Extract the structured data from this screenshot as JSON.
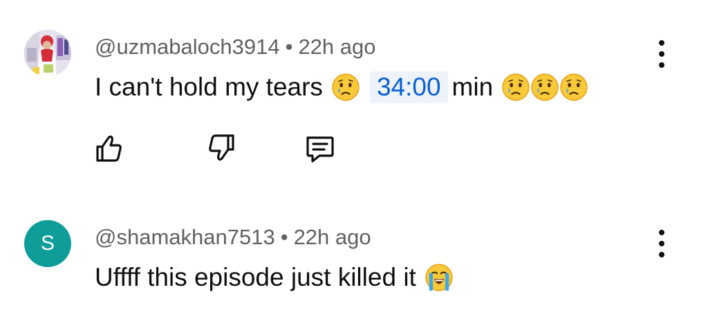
{
  "comments": [
    {
      "handle": "@uzmabaloch3914",
      "separator": "•",
      "time": "22h ago",
      "text_before": "I can't hold my tears",
      "timestamp_link": "34:00",
      "text_after": "min",
      "avatar_icon": "profile-photo",
      "emoji_name": "crying-face"
    },
    {
      "handle": "@shamakhan7513",
      "separator": "•",
      "time": "22h ago",
      "text": "Uffff this episode just killed it",
      "avatar_letter": "S",
      "avatar_color": "#0f9d9a",
      "emoji_name": "loudly-crying-face"
    }
  ],
  "actions": {
    "like_icon": "thumbs-up-icon",
    "dislike_icon": "thumbs-down-icon",
    "reply_icon": "reply-comment-icon"
  },
  "colors": {
    "link": "#065fd4",
    "meta": "#606060",
    "text": "#0f0f0f"
  }
}
